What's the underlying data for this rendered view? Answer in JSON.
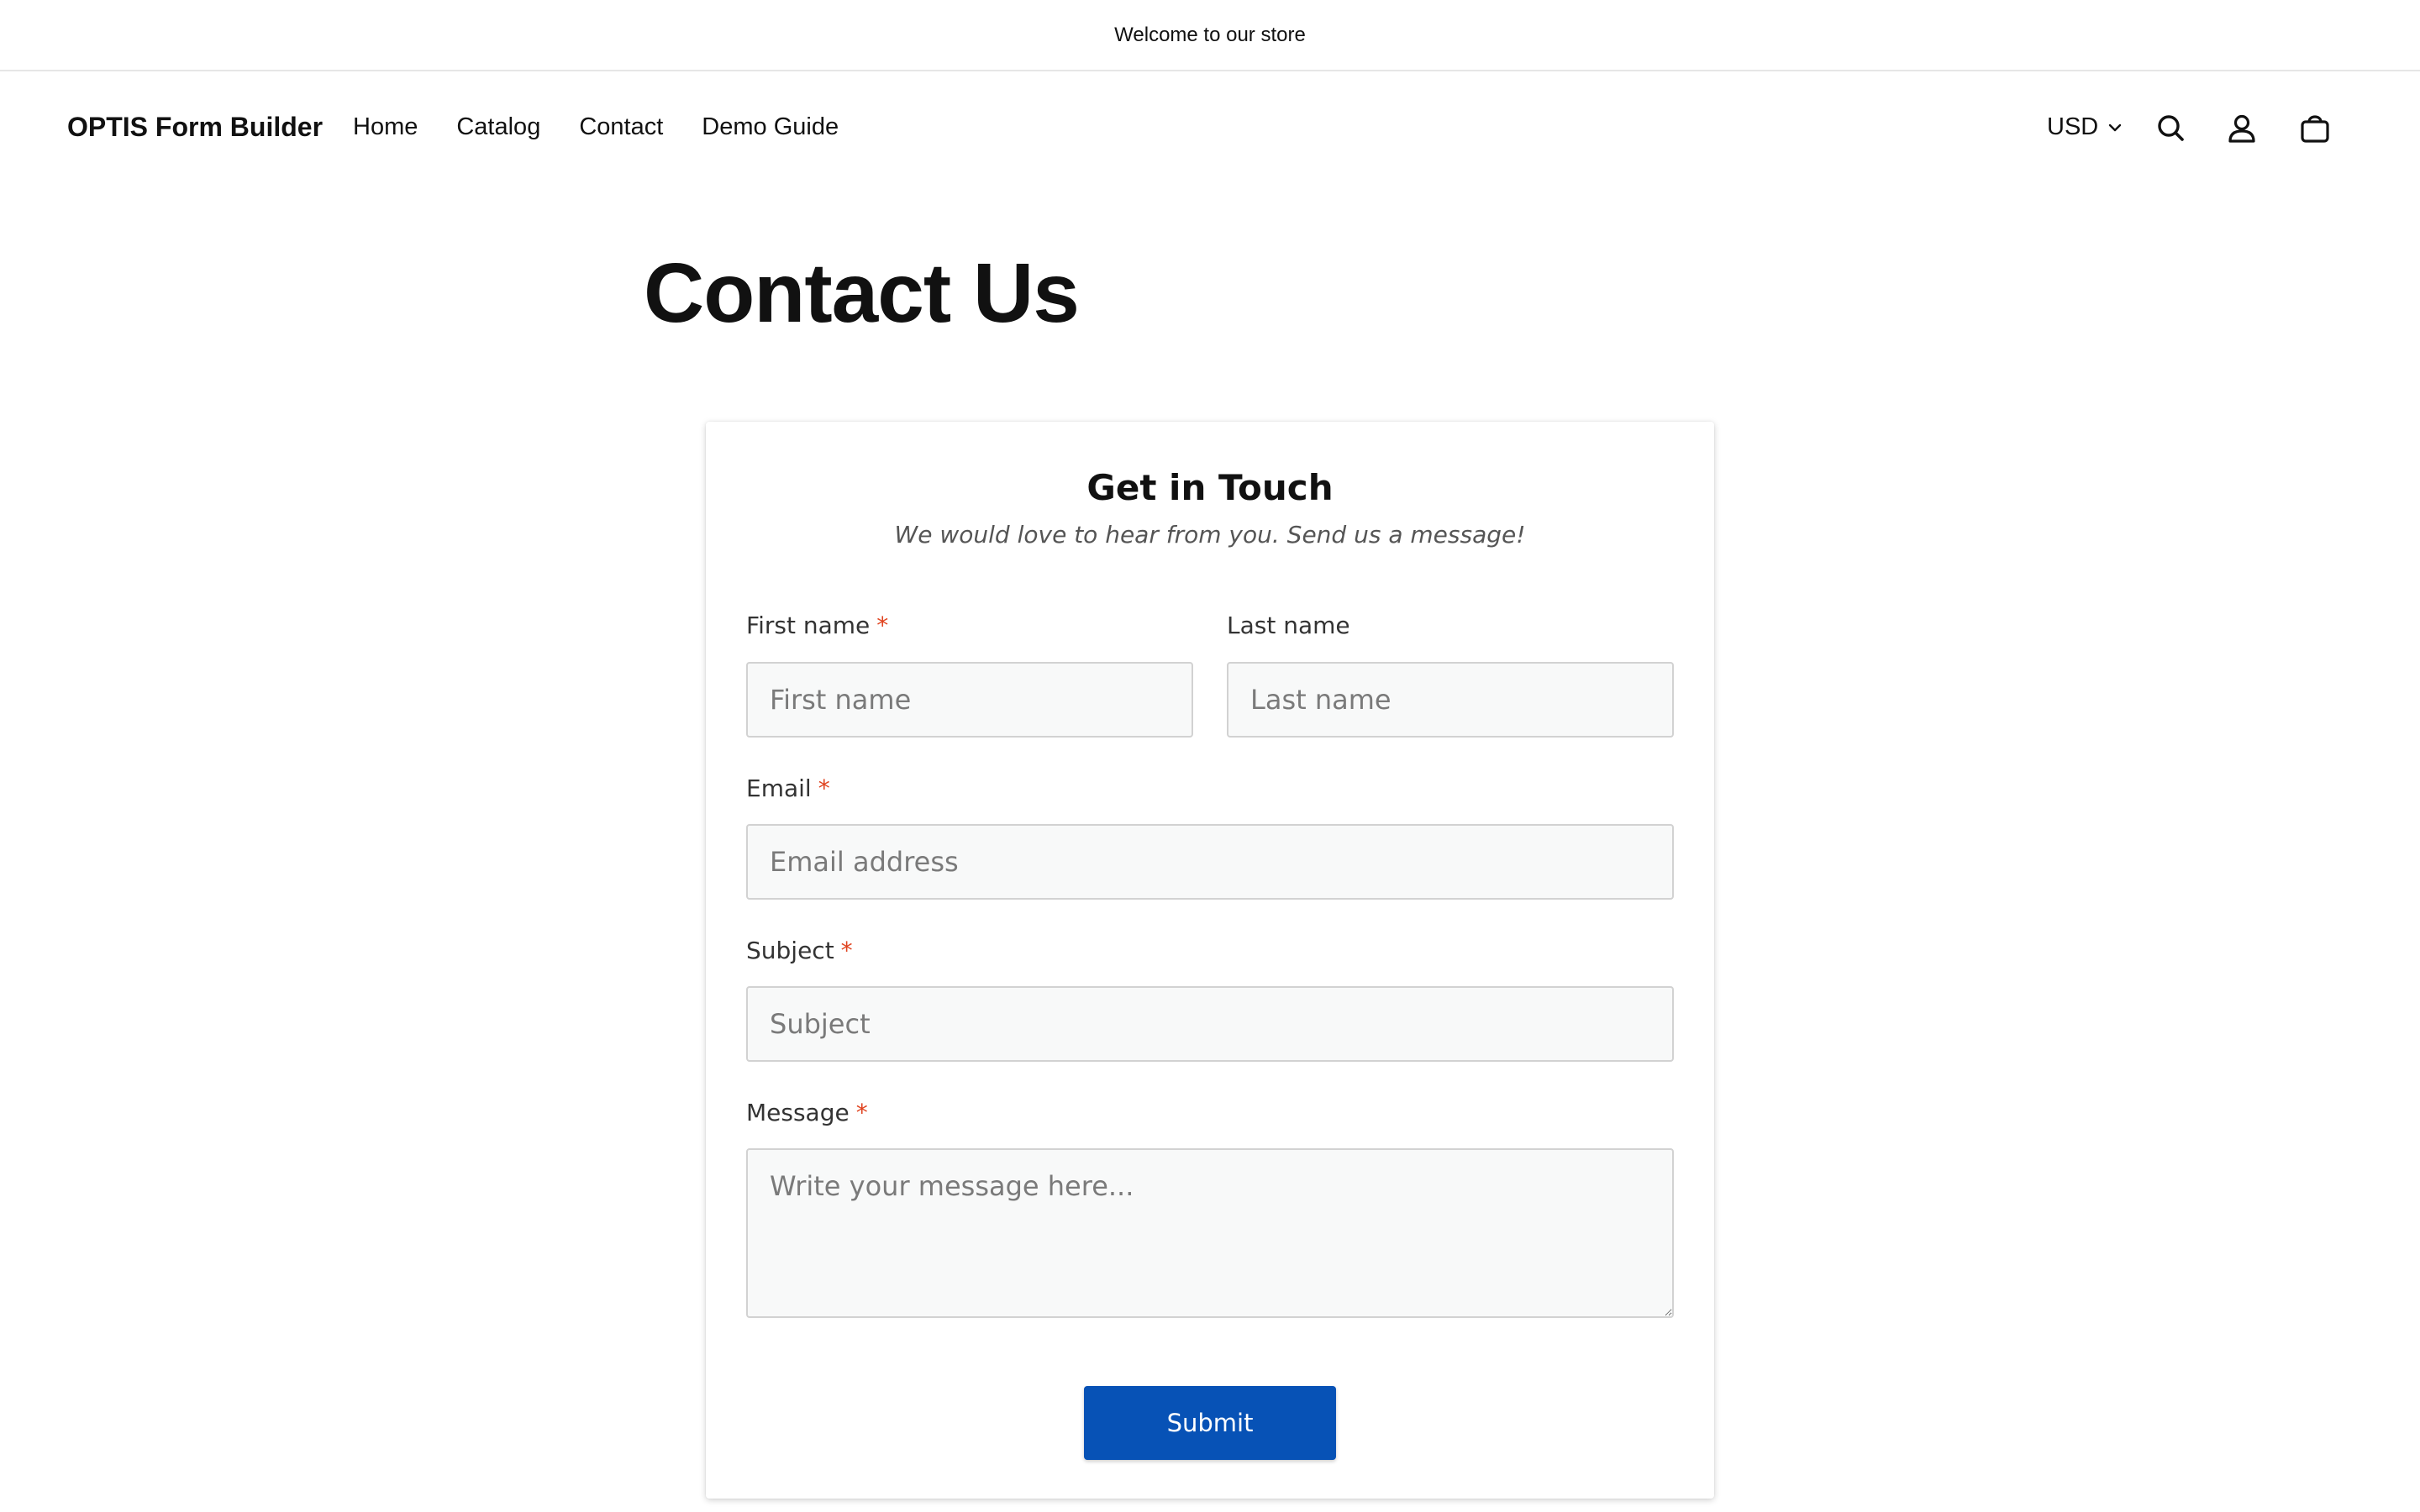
{
  "announcement": "Welcome to our store",
  "header": {
    "brand": "OPTIS Form Builder",
    "nav": [
      "Home",
      "Catalog",
      "Contact",
      "Demo Guide"
    ],
    "currency": "USD",
    "icons": [
      "search-icon",
      "account-icon",
      "cart-icon"
    ]
  },
  "page_title": "Contact Us",
  "form": {
    "title": "Get in Touch",
    "subtitle": "We would love to hear from you. Send us a message!",
    "required_marker": "*",
    "first_name": {
      "label": "First name",
      "placeholder": "First name"
    },
    "last_name": {
      "label": "Last name",
      "placeholder": "Last name"
    },
    "email": {
      "label": "Email",
      "placeholder": "Email address"
    },
    "subject": {
      "label": "Subject",
      "placeholder": "Subject"
    },
    "message": {
      "label": "Message",
      "placeholder": "Write your message here..."
    },
    "submit_label": "Submit"
  },
  "colors": {
    "accent": "#0752b6",
    "required": "#e0431f"
  }
}
